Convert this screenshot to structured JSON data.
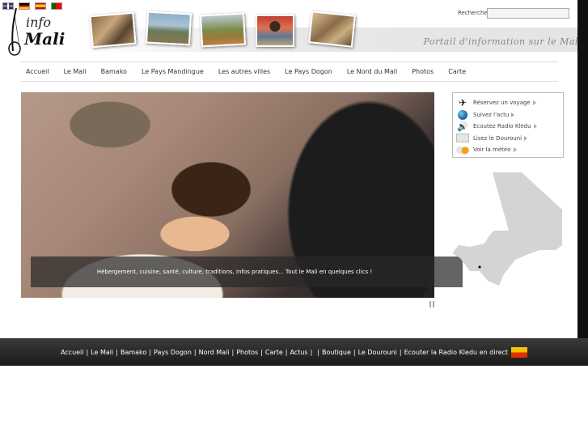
{
  "languages": [
    {
      "code": "en",
      "name": "English"
    },
    {
      "code": "de",
      "name": "Deutsch"
    },
    {
      "code": "es",
      "name": "Español"
    },
    {
      "code": "pt",
      "name": "Português"
    }
  ],
  "logo": {
    "line1": "info",
    "line2": "Mali"
  },
  "tagline": "Portail d'information sur le Mali",
  "search": {
    "label": "Recherche",
    "value": ""
  },
  "nav": {
    "items": [
      "Accueil",
      "Le Mali",
      "Bamako",
      "Le Pays Mandingue",
      "Les autres villes",
      "Le Pays Dogon",
      "Le Nord du Mali",
      "Photos",
      "Carte"
    ]
  },
  "slideshow": {
    "caption": "Hébergement, cuisine, santé, culture, traditions, infos pratiques... Tout le Mali en quelques clics !"
  },
  "sidebar": {
    "items": [
      {
        "label": "Réservez un voyage",
        "icon": "plane-icon"
      },
      {
        "label": "Suivez l'actu",
        "icon": "globe-icon"
      },
      {
        "label": "Ecoutez Radio Kledu",
        "icon": "speaker-icon"
      },
      {
        "label": "Lisez le Dourouni",
        "icon": "newspaper-icon"
      },
      {
        "label": "Voir la météo",
        "icon": "weather-icon"
      }
    ]
  },
  "footer": {
    "links": [
      "Accueil",
      "Le Mali",
      "Bamako",
      "Pays Dogon",
      "Nord Mali",
      "Photos",
      "Carte",
      "Actus",
      "",
      "Boutique",
      "Le Dourouni",
      "Ecouter la Radio Kledu en direct"
    ]
  },
  "colors": {
    "footer_bg": "#222222",
    "map_fill": "#d4d4d4",
    "accent": "#111111"
  }
}
